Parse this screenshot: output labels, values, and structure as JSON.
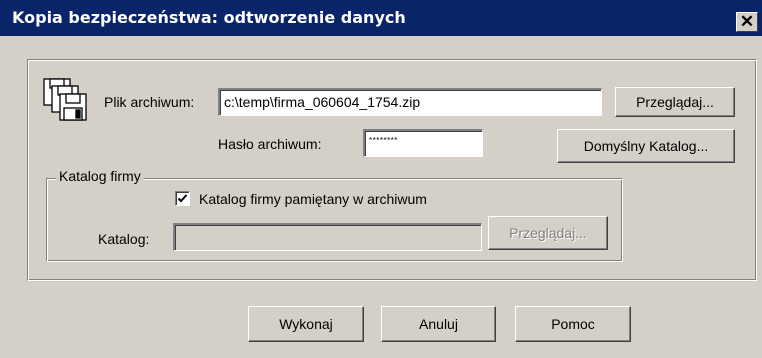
{
  "window": {
    "title": "Kopia bezpieczeństwa: odtworzenie danych",
    "close_glyph": "✕"
  },
  "archive": {
    "file_label": "Plik archiwum:",
    "file_value": "c:\\temp\\firma_060604_1754.zip",
    "password_label": "Hasło archiwum:",
    "password_value": "********",
    "browse_label": "Przeglądaj...",
    "default_dir_label": "Domyślny Katalog...",
    "icon": "floppy-disks-icon"
  },
  "company_dir": {
    "group_label": "Katalog firmy",
    "remembered_checkbox_label": "Katalog firmy pamiętany w archiwum",
    "remembered_checked": true,
    "dir_label": "Katalog:",
    "dir_value": "",
    "browse_label": "Przeglądaj..."
  },
  "actions": {
    "execute_label": "Wykonaj",
    "cancel_label": "Anuluj",
    "help_label": "Pomoc"
  },
  "colors": {
    "titlebar": "#0a246a",
    "face": "#d4d0c8"
  }
}
